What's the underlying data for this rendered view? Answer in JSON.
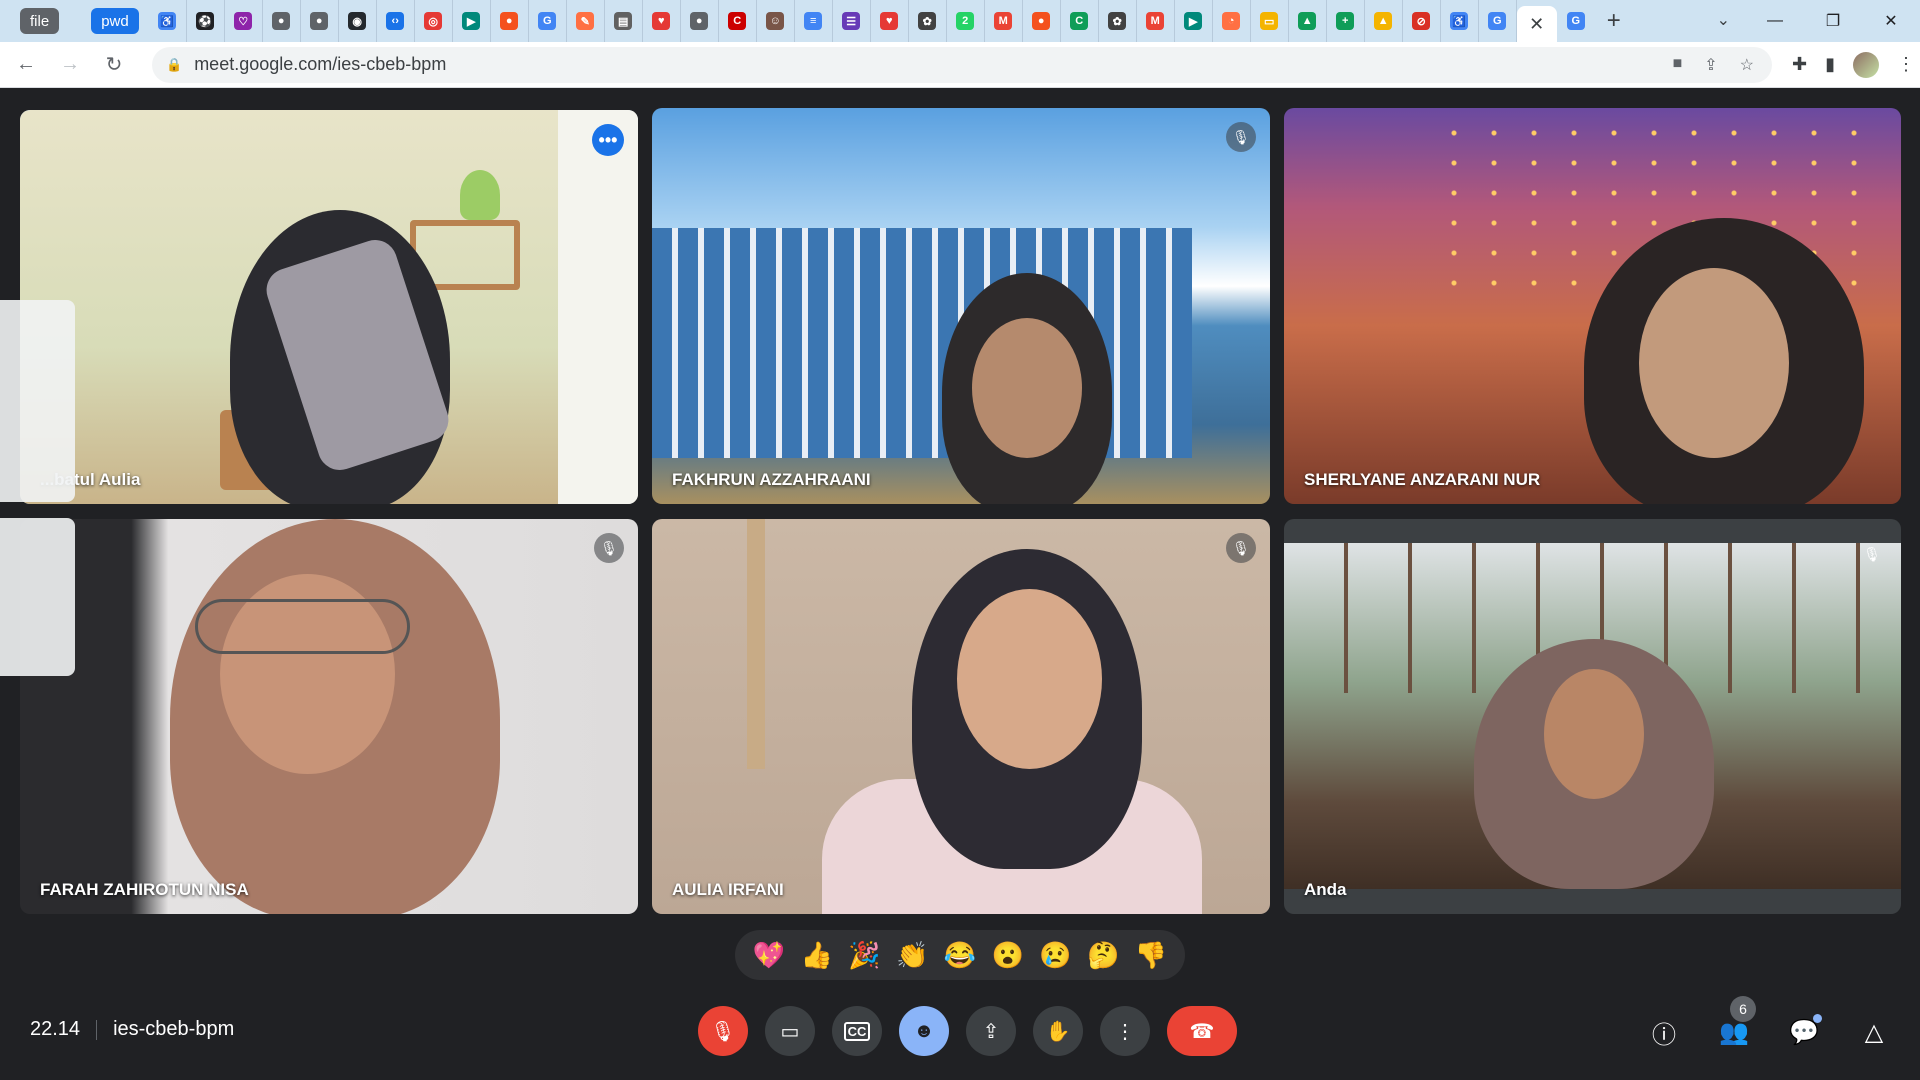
{
  "browser": {
    "tab_groups": [
      "file",
      "pwd"
    ],
    "tab_icons": [
      {
        "icon": "accessibility-icon",
        "color": "#4285f4",
        "glyph": "♿"
      },
      {
        "icon": "soccer-icon",
        "color": "#202124",
        "glyph": "⚽"
      },
      {
        "icon": "heart-outline-icon",
        "color": "#8e24aa",
        "glyph": "♡"
      },
      {
        "icon": "globe-icon",
        "color": "#5f6368",
        "glyph": "●"
      },
      {
        "icon": "globe-icon",
        "color": "#5f6368",
        "glyph": "●"
      },
      {
        "icon": "github-icon",
        "color": "#24292e",
        "glyph": "◉"
      },
      {
        "icon": "code-icon",
        "color": "#1a73e8",
        "glyph": "‹›"
      },
      {
        "icon": "target-icon",
        "color": "#e53935",
        "glyph": "◎"
      },
      {
        "icon": "meet-icon",
        "color": "#00897b",
        "glyph": "▶"
      },
      {
        "icon": "record-icon",
        "color": "#f4511e",
        "glyph": "●"
      },
      {
        "icon": "google-icon",
        "color": "#4285f4",
        "glyph": "G"
      },
      {
        "icon": "swirl-icon",
        "color": "#ff7043",
        "glyph": "✎"
      },
      {
        "icon": "doc-icon",
        "color": "#616161",
        "glyph": "▤"
      },
      {
        "icon": "heart-icon",
        "color": "#e53935",
        "glyph": "♥"
      },
      {
        "icon": "globe-icon",
        "color": "#5f6368",
        "glyph": "●"
      },
      {
        "icon": "cnn-icon",
        "color": "#cc0000",
        "glyph": "C"
      },
      {
        "icon": "face-icon",
        "color": "#795548",
        "glyph": "☺"
      },
      {
        "icon": "docs-icon",
        "color": "#4285f4",
        "glyph": "≡"
      },
      {
        "icon": "forms-icon",
        "color": "#673ab7",
        "glyph": "☰"
      },
      {
        "icon": "heart-icon",
        "color": "#e53935",
        "glyph": "♥"
      },
      {
        "icon": "chatgpt-icon",
        "color": "#424242",
        "glyph": "✿"
      },
      {
        "icon": "whatsapp-icon",
        "color": "#25d366",
        "glyph": "2"
      },
      {
        "icon": "gmail-icon",
        "color": "#ea4335",
        "glyph": "M"
      },
      {
        "icon": "record-icon",
        "color": "#f4511e",
        "glyph": "●"
      },
      {
        "icon": "classroom-icon",
        "color": "#0f9d58",
        "glyph": "C"
      },
      {
        "icon": "chatgpt-icon",
        "color": "#424242",
        "glyph": "✿"
      },
      {
        "icon": "gmail-icon",
        "color": "#ea4335",
        "glyph": "M"
      },
      {
        "icon": "meet-icon",
        "color": "#00897b",
        "glyph": "▶"
      },
      {
        "icon": "circle-icon",
        "color": "#ff7043",
        "glyph": "◔"
      },
      {
        "icon": "slides-icon",
        "color": "#f4b400",
        "glyph": "▭"
      },
      {
        "icon": "drive-icon",
        "color": "#0f9d58",
        "glyph": "▲"
      },
      {
        "icon": "plus-icon",
        "color": "#0f9d58",
        "glyph": "+"
      },
      {
        "icon": "drive-icon",
        "color": "#f4b400",
        "glyph": "▲"
      },
      {
        "icon": "stop-icon",
        "color": "#d93025",
        "glyph": "⊘"
      },
      {
        "icon": "accessibility-icon",
        "color": "#4285f4",
        "glyph": "♿"
      },
      {
        "icon": "google-icon",
        "color": "#4285f4",
        "glyph": "G"
      }
    ],
    "active_tab_close": "✕",
    "extra_tab": {
      "icon": "google-icon",
      "color": "#4285f4",
      "glyph": "G"
    },
    "new_tab": "+",
    "dropdown": "⌄",
    "window_controls": [
      "—",
      "❐",
      "✕"
    ],
    "url": "meet.google.com/ies-cbeb-bpm"
  },
  "participants": [
    {
      "name": "Hibbatul Aulia",
      "visible_name": "...batul Aulia",
      "muted": false,
      "speaking": true
    },
    {
      "name": "FAKHRUN AZZAHRAANI",
      "muted": true
    },
    {
      "name": "SHERLYANE ANZARANI NUR",
      "muted": true
    },
    {
      "name": "FARAH ZAHIROTUN NISA",
      "muted": true
    },
    {
      "name": "AULIA IRFANI",
      "muted": true
    },
    {
      "name": "Anda",
      "muted": true
    }
  ],
  "reactions": [
    "💖",
    "👍",
    "🎉",
    "👏",
    "😂",
    "😮",
    "😢",
    "🤔",
    "👎"
  ],
  "meeting": {
    "time": "22.14",
    "code": "ies-cbeb-bpm",
    "participant_count": "6"
  },
  "colors": {
    "background": "#202124",
    "end_call": "#ea4335",
    "active_speaker": "#8ab4f8",
    "reactions_active": "#8ab4f8"
  }
}
